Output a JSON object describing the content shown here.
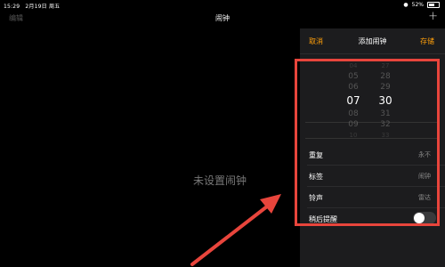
{
  "status_bar": {
    "time": "15:29",
    "date": "2月19日 周五",
    "battery": "52%",
    "battery_fill": 0.52,
    "wifi_icon": "wifi-icon"
  },
  "nav": {
    "edit_label": "编辑",
    "title": "闹钟",
    "add_icon": "plus-icon"
  },
  "empty_state": "未设置闹钟",
  "add_alarm": {
    "cancel_label": "取消",
    "title": "添加闹钟",
    "save_label": "存储",
    "picker": {
      "hours": [
        "04",
        "05",
        "06",
        "07",
        "08",
        "09",
        "10"
      ],
      "minutes": [
        "27",
        "28",
        "29",
        "30",
        "31",
        "32",
        "33"
      ],
      "selected_hour": "07",
      "selected_minute": "30"
    },
    "rows": [
      {
        "label": "重复",
        "value": "永不"
      },
      {
        "label": "标签",
        "value": "闹钟"
      },
      {
        "label": "铃声",
        "value": "雷达"
      },
      {
        "label": "稍后提醒",
        "toggle": false
      }
    ]
  },
  "annotation": {
    "color": "#e8453c",
    "type": "arrow-and-box"
  }
}
